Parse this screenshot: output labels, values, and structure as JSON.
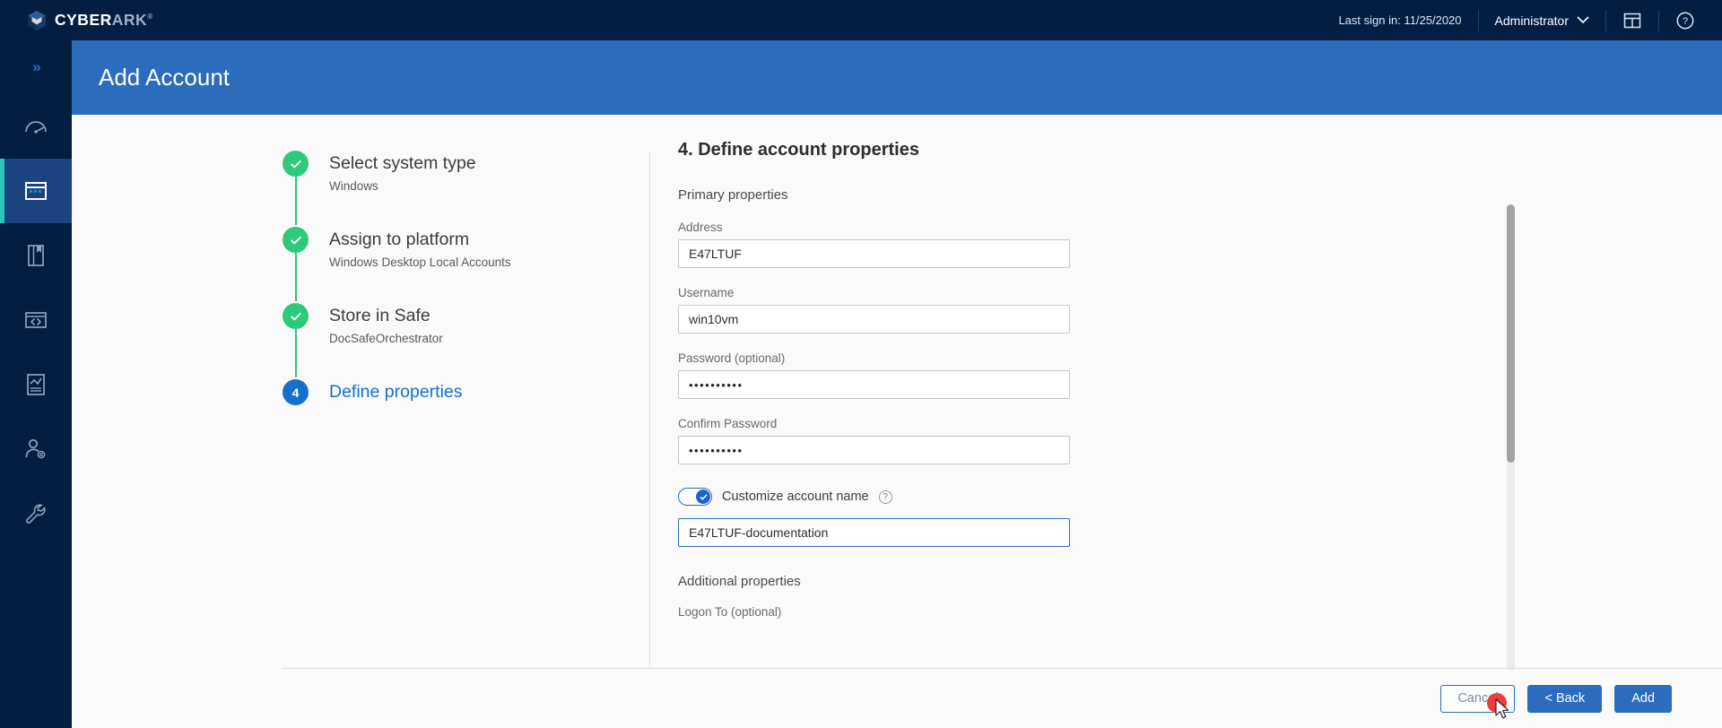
{
  "brand": {
    "name_primary": "CYBER",
    "name_secondary": "ARK",
    "trademark": "®",
    "logo_icon": "cyberark-cube-logo",
    "accent_color": "#2C6CBD",
    "topbar_color": "#041E42",
    "active_nav_color": "#1B4380",
    "teal_accent": "#2ec5c0",
    "success_color": "#2ec97b"
  },
  "topbar": {
    "last_sign_in": "Last sign in: 11/25/2020",
    "user_name": "Administrator",
    "user_chevron_icon": "chevron-down-icon",
    "layout_icon": "panel-layout-icon",
    "help_icon": "help-circle-icon"
  },
  "sidebar": {
    "expander_glyph": "»",
    "items": [
      {
        "name": "expander",
        "icon": "double-chevron-right-icon",
        "active": false
      },
      {
        "name": "dashboard",
        "icon": "gauge-dashboard-icon",
        "active": false
      },
      {
        "name": "accounts",
        "icon": "accounts-password-window-icon",
        "active": true
      },
      {
        "name": "policies",
        "icon": "book-bookmark-icon",
        "active": false
      },
      {
        "name": "applications",
        "icon": "code-brackets-icon",
        "active": false
      },
      {
        "name": "reports",
        "icon": "report-chart-document-icon",
        "active": false
      },
      {
        "name": "user-management",
        "icon": "user-gear-icon",
        "active": false
      },
      {
        "name": "administration",
        "icon": "wrench-icon",
        "active": false
      }
    ]
  },
  "page": {
    "title": "Add Account"
  },
  "wizard": {
    "steps": [
      {
        "index": "1",
        "title": "Select system type",
        "subtitle": "Windows",
        "state": "done",
        "check_icon": "check-icon"
      },
      {
        "index": "2",
        "title": "Assign to platform",
        "subtitle": "Windows Desktop Local Accounts",
        "state": "done",
        "check_icon": "check-icon"
      },
      {
        "index": "3",
        "title": "Store in Safe",
        "subtitle": "DocSafeOrchestrator",
        "state": "done",
        "check_icon": "check-icon"
      },
      {
        "index": "4",
        "title": "Define properties",
        "subtitle": "",
        "state": "current",
        "check_icon": ""
      }
    ]
  },
  "form": {
    "heading": "4. Define account properties",
    "primary_section_label": "Primary properties",
    "additional_section_label": "Additional properties",
    "fields": {
      "address": {
        "label": "Address",
        "value": "E47LTUF",
        "placeholder": ""
      },
      "username": {
        "label": "Username",
        "value": "win10vm",
        "placeholder": ""
      },
      "password": {
        "label": "Password (optional)",
        "value": "••••••••••",
        "placeholder": ""
      },
      "confirm_password": {
        "label": "Confirm Password",
        "value": "••••••••••",
        "placeholder": ""
      },
      "account_name": {
        "label": "",
        "value": "E47LTUF-documentation",
        "placeholder": ""
      },
      "logon_to": {
        "label": "Logon To (optional)",
        "value": "",
        "placeholder": ""
      }
    },
    "customize_toggle": {
      "label": "Customize account name",
      "state": "on",
      "help_icon": "help-circle-icon",
      "help_glyph": "?"
    }
  },
  "footer": {
    "cancel_label": "Cancel",
    "back_label": "< Back",
    "add_label": "Add"
  },
  "cursor": {
    "click_indicator": "red-click-dot",
    "pointer_icon": "mouse-arrow-cursor"
  }
}
